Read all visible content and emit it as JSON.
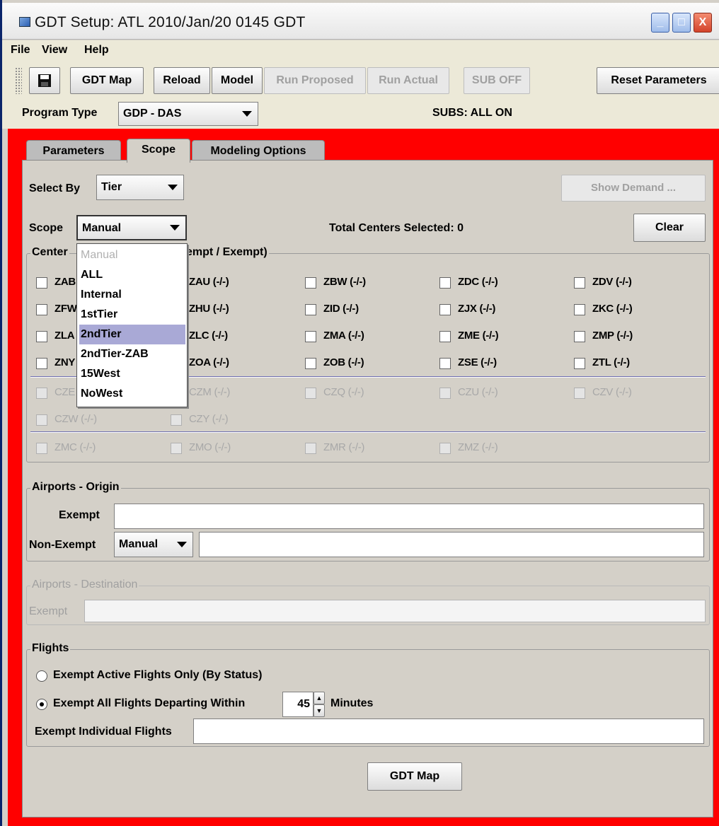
{
  "window": {
    "title": "GDT Setup: ATL 2010/Jan/20 0145 GDT",
    "minimize_label": "_",
    "maximize_label": "□",
    "close_label": "X"
  },
  "menubar": {
    "items": [
      {
        "label": "File"
      },
      {
        "label": "View"
      },
      {
        "label": "Help"
      }
    ]
  },
  "toolbar": {
    "save_icon": "floppy-disk-icon",
    "gdt_map": "GDT Map",
    "reload": "Reload",
    "model": "Model",
    "run_proposed": "Run Proposed",
    "run_actual": "Run Actual",
    "sub_off": "SUB OFF",
    "reset_parameters": "Reset Parameters"
  },
  "program": {
    "type_label": "Program Type",
    "type_value": "GDP - DAS",
    "subs_status": "SUBS: ALL ON"
  },
  "tabs": [
    {
      "label": "Parameters"
    },
    {
      "label": "Scope"
    },
    {
      "label": "Modeling Options"
    }
  ],
  "scope": {
    "select_by_label": "Select By",
    "select_by_value": "Tier",
    "show_demand": "Show Demand ...",
    "scope_label": "Scope",
    "scope_value": "Manual",
    "total_centers": "Total Centers Selected: 0",
    "clear": "Clear",
    "centers_legend": "Center",
    "centers_legend_tail": "empt / Exempt)"
  },
  "dropdown": {
    "options": [
      {
        "label": "Manual"
      },
      {
        "label": "ALL"
      },
      {
        "label": "Internal"
      },
      {
        "label": "1stTier"
      },
      {
        "label": "2ndTier"
      },
      {
        "label": "2ndTier-ZAB"
      },
      {
        "label": "15West"
      },
      {
        "label": "NoWest"
      }
    ],
    "selected": "2ndTier"
  },
  "centers": {
    "row1": [
      "ZAB",
      "ZAU (-/-)",
      "ZBW (-/-)",
      "ZDC (-/-)",
      "ZDV (-/-)"
    ],
    "row2": [
      "ZFW",
      "ZHU (-/-)",
      "ZID (-/-)",
      "ZJX (-/-)",
      "ZKC (-/-)"
    ],
    "row3": [
      "ZLA",
      "ZLC (-/-)",
      "ZMA (-/-)",
      "ZME (-/-)",
      "ZMP (-/-)"
    ],
    "row4": [
      "ZNY",
      "ZOA (-/-)",
      "ZOB (-/-)",
      "ZSE (-/-)",
      "ZTL (-/-)"
    ],
    "row5": [
      "CZE",
      "CZM (-/-)",
      "CZQ (-/-)",
      "CZU (-/-)",
      "CZV (-/-)"
    ],
    "row6": [
      "CZW (-/-)",
      "CZY (-/-)"
    ],
    "row7": [
      "ZMC (-/-)",
      "ZMO (-/-)",
      "ZMR (-/-)",
      "ZMZ (-/-)"
    ]
  },
  "origin": {
    "legend": "Airports - Origin",
    "exempt_label": "Exempt",
    "exempt_value": "",
    "nonexempt_label": "Non-Exempt",
    "nonexempt_mode": "Manual",
    "nonexempt_value": ""
  },
  "destination": {
    "legend": "Airports - Destination",
    "exempt_label": "Exempt",
    "exempt_value": ""
  },
  "flights": {
    "legend": "Flights",
    "option_active": "Exempt Active Flights Only (By Status)",
    "option_all": "Exempt All Flights Departing Within",
    "minutes_value": "45",
    "minutes_label": "Minutes",
    "individual_label": "Exempt Individual Flights",
    "individual_value": ""
  },
  "bottom": {
    "gdt_map": "GDT Map"
  }
}
